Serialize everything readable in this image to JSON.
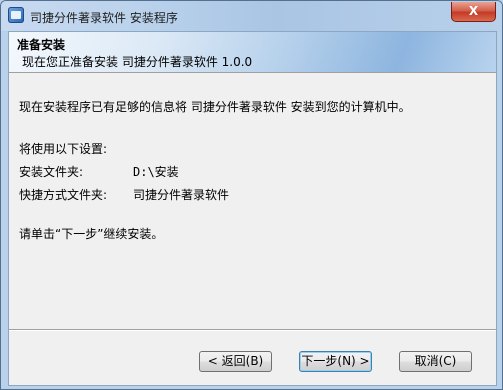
{
  "window": {
    "title": "司捷分件著录软件 安装程序",
    "close_label": "X"
  },
  "header": {
    "title": "准备安装",
    "subtitle": "现在您正准备安装 司捷分件著录软件 1.0.0"
  },
  "content": {
    "intro": "现在安装程序已有足够的信息将 司捷分件著录软件 安装到您的计算机中。",
    "settings_heading": "将使用以下设置:",
    "install_folder_label": "安装文件夹:",
    "install_folder_value": "D:\\安装",
    "shortcut_folder_label": "快捷方式文件夹:",
    "shortcut_folder_value": "司捷分件著录软件",
    "instruction": "请单击“下一步”继续安装。"
  },
  "buttons": {
    "back": "< 返回(B)",
    "next": "下一步(N) >",
    "cancel": "取消(C)"
  }
}
